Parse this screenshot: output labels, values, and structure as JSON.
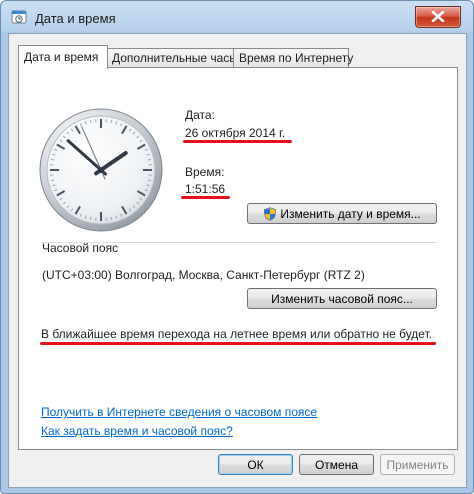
{
  "window": {
    "title": "Дата и время",
    "close_label": "Закрыть"
  },
  "tabs": [
    {
      "label": "Дата и время",
      "active": true
    },
    {
      "label": "Дополнительные часы",
      "active": false
    },
    {
      "label": "Время по Интернету",
      "active": false
    }
  ],
  "datetime": {
    "date_label": "Дата:",
    "date_value": "26 октября 2014 г.",
    "time_label": "Время:",
    "time_value": "1:51:56",
    "change_button": "Изменить дату и время..."
  },
  "clock": {
    "hours": 1,
    "minutes": 51,
    "seconds": 56
  },
  "timezone": {
    "label": "Часовой пояс",
    "value": "(UTC+03:00) Волгоград, Москва, Санкт-Петербург (RTZ 2)",
    "change_button": "Изменить часовой пояс..."
  },
  "dst_notice": "В ближайшее время перехода на летнее время или обратно не будет.",
  "links": {
    "online_info": "Получить в Интернете сведения о часовом поясе",
    "how_to": "Как задать время и часовой пояс?"
  },
  "footer": {
    "ok": "ОК",
    "cancel": "Отмена",
    "apply": "Применить"
  },
  "colors": {
    "annotation_red": "#e5101a",
    "link_blue": "#0066cc",
    "frame_blue": "#a9c8e7"
  }
}
